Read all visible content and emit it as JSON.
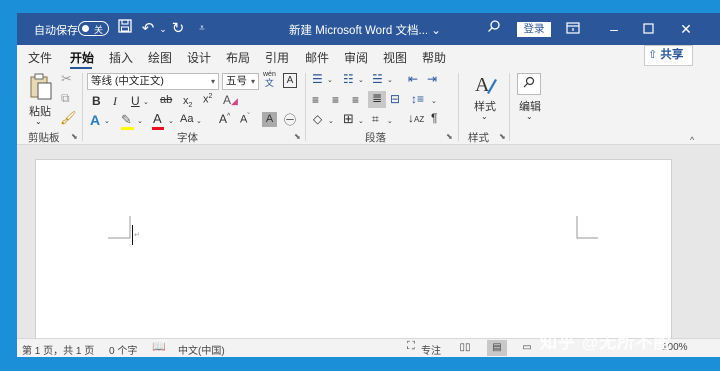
{
  "titlebar": {
    "autosave_label": "自动保存",
    "autosave_state": "关",
    "doc_title": "新建 Microsoft Word 文档... ⌄",
    "login_label": "登录",
    "icons": [
      "save-icon",
      "undo-icon",
      "redo-icon",
      "customize-icon",
      "search-icon",
      "ribbon-display-icon",
      "minimize-icon",
      "maximize-icon",
      "close-icon"
    ]
  },
  "tabs": [
    "文件",
    "开始",
    "插入",
    "绘图",
    "设计",
    "布局",
    "引用",
    "邮件",
    "审阅",
    "视图",
    "帮助"
  ],
  "share_label": "共享",
  "ribbon": {
    "clipboard": {
      "paste": "粘贴",
      "label": "剪贴板"
    },
    "font": {
      "name": "等线 (中文正文)",
      "size": "五号",
      "wen": "wén",
      "wen_char": "文",
      "label": "字体"
    },
    "paragraph": {
      "label": "段落"
    },
    "styles": {
      "button": "样式",
      "label": "样式"
    },
    "editing": {
      "button": "编辑"
    }
  },
  "statusbar": {
    "page": "第 1 页，共 1 页",
    "words": "0 个字",
    "language": "中文(中国)",
    "focus": "专注",
    "zoom": "100%"
  },
  "watermark": "知乎 @无所不能",
  "colors": {
    "title_bar": "#2b579a",
    "highlight": "#ffff00",
    "font_color": "#e81123",
    "desktop": "#1b8fd8"
  }
}
